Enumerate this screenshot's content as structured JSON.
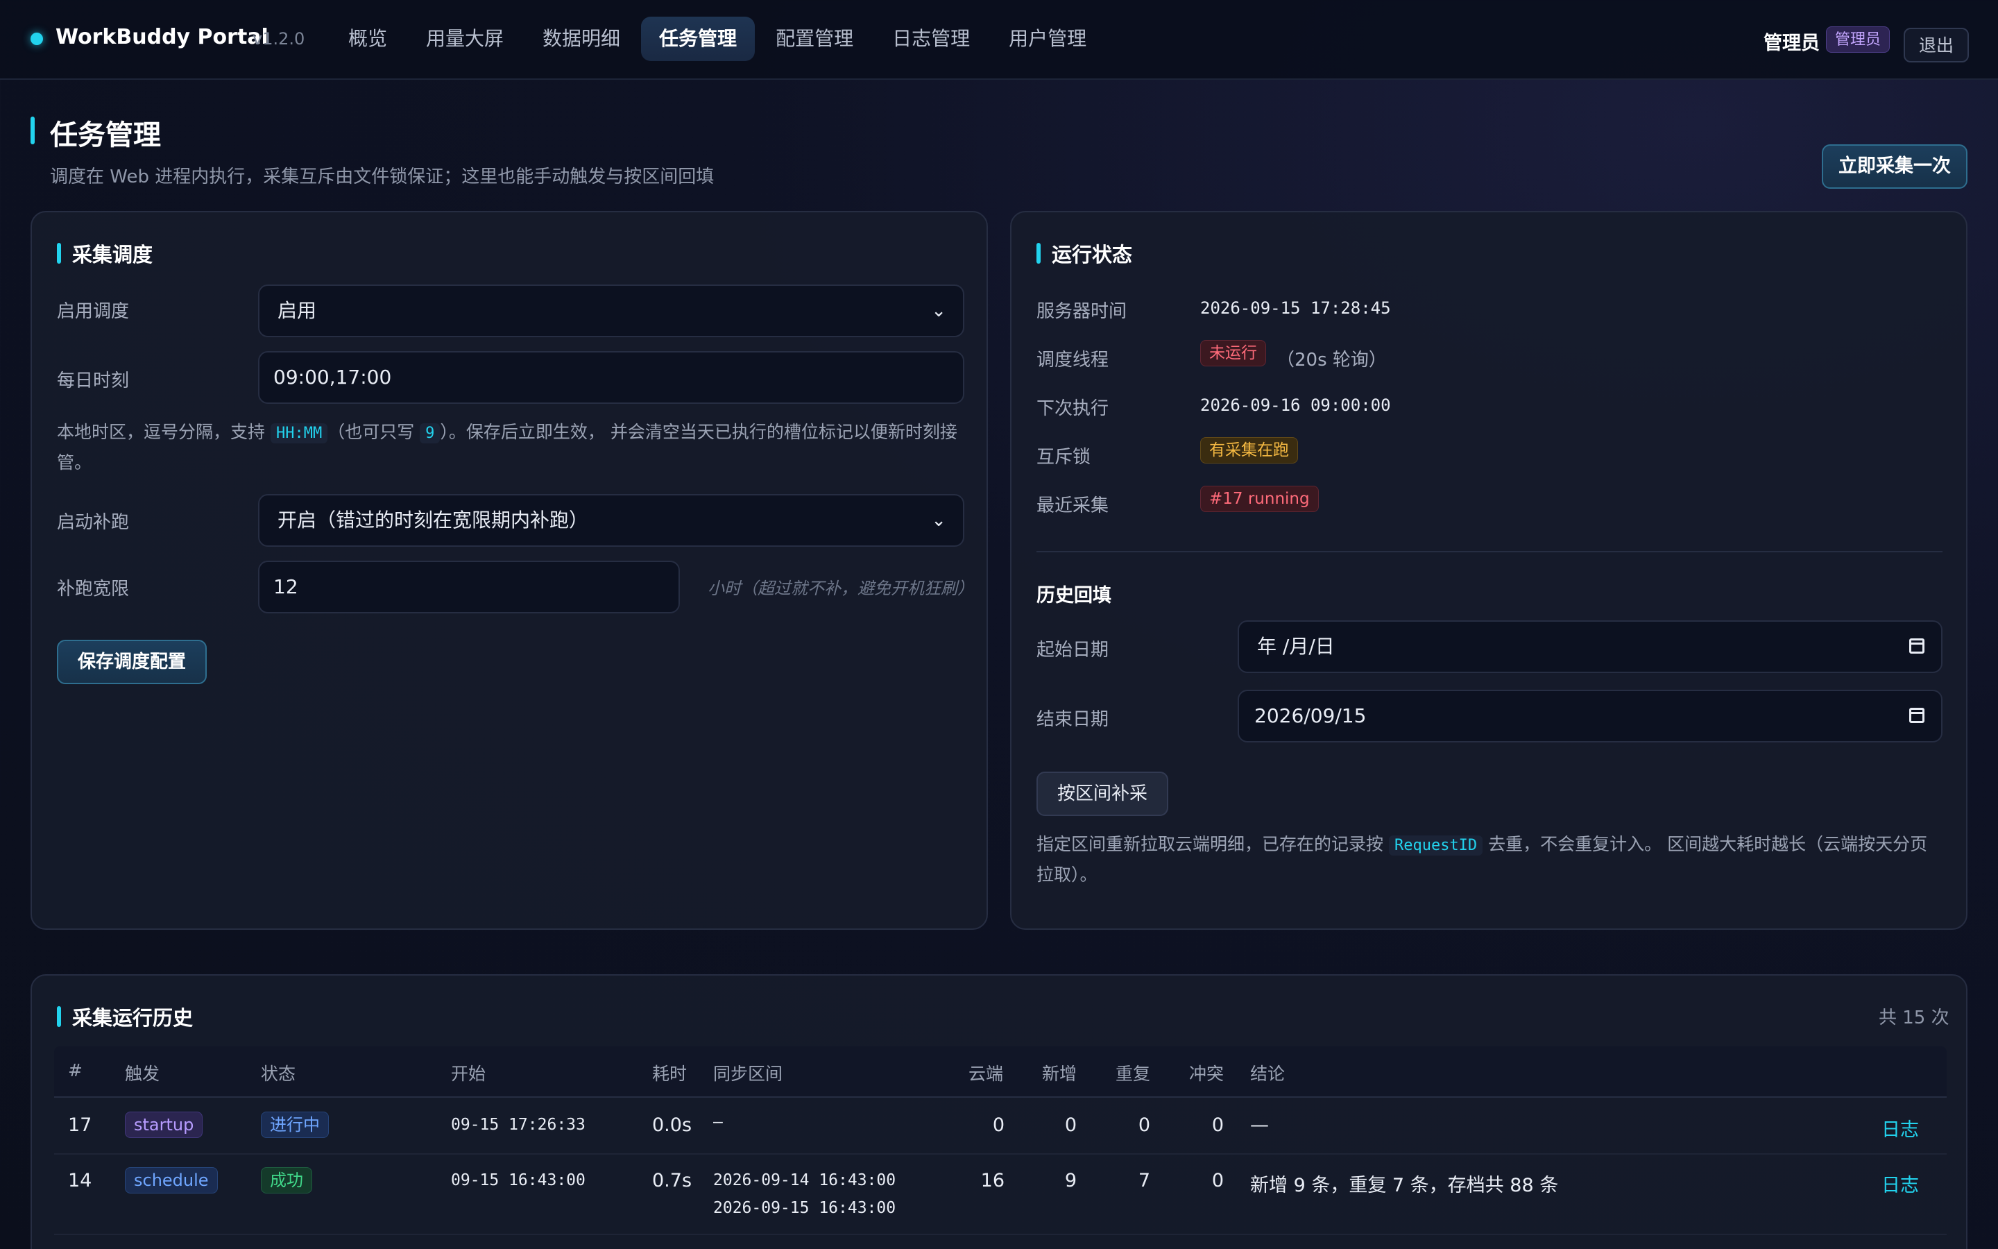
{
  "app": {
    "name": "WorkBuddy Portal",
    "version": "v1.2.0"
  },
  "nav": [
    {
      "label": "概览",
      "active": false
    },
    {
      "label": "用量大屏",
      "active": false
    },
    {
      "label": "数据明细",
      "active": false
    },
    {
      "label": "任务管理",
      "active": true
    },
    {
      "label": "配置管理",
      "active": false
    },
    {
      "label": "日志管理",
      "active": false
    },
    {
      "label": "用户管理",
      "active": false
    }
  ],
  "user": {
    "name": "管理员",
    "role": "管理员",
    "logout": "退出"
  },
  "page": {
    "title": "任务管理",
    "subtitle": "调度在 Web 进程内执行，采集互斥由文件锁保证；这里也能手动触发与按区间回填",
    "collect_now": "立即采集一次"
  },
  "schedule": {
    "title": "采集调度",
    "enable_label": "启用调度",
    "enable_value": "启用",
    "times_label": "每日时刻",
    "times_value": "09:00,17:00",
    "hint_pre": "本地时区，逗号分隔，支持",
    "hint_code1": "HH:MM",
    "hint_mid": "（也可只写",
    "hint_code2": "9",
    "hint_post": "）。保存后立即生效， 并会清空当天已执行的槽位标记以便新时刻接管。",
    "catchup_label": "启动补跑",
    "catchup_value": "开启（错过的时刻在宽限期内补跑）",
    "grace_label": "补跑宽限",
    "grace_value": "12",
    "grace_hint": "小时（超过就不补，避免开机狂刷）",
    "save": "保存调度配置"
  },
  "status": {
    "title": "运行状态",
    "server_time_label": "服务器时间",
    "server_time": "2026-09-15 17:28:45",
    "thread_label": "调度线程",
    "thread_badge": "未运行",
    "thread_note": "（20s 轮询）",
    "next_label": "下次执行",
    "next_value": "2026-09-16 09:00:00",
    "lock_label": "互斥锁",
    "lock_badge": "有采集在跑",
    "last_label": "最近采集",
    "last_badge": "#17 running"
  },
  "backfill": {
    "title": "历史回填",
    "start_label": "起始日期",
    "start_value": "年 /月/日",
    "end_label": "结束日期",
    "end_value": "2026/09/15",
    "button": "按区间补采",
    "hint_pre": "指定区间重新拉取云端明细，已存在的记录按",
    "hint_code": "RequestID",
    "hint_post": "去重，不会重复计入。 区间越大耗时越长（云端按天分页拉取）。"
  },
  "history": {
    "title": "采集运行历史",
    "total": "共 15 次",
    "columns": [
      "#",
      "触发",
      "状态",
      "开始",
      "耗时",
      "同步区间",
      "云端",
      "新增",
      "重复",
      "冲突",
      "结论"
    ],
    "rows": [
      {
        "id": "17",
        "trigger": "startup",
        "status": "进行中",
        "start": "09-15 17:26:33",
        "duration": "0.0s",
        "range1": "–",
        "range2": "",
        "cloud": "0",
        "new": "0",
        "dup": "0",
        "conflict": "0",
        "result": "—",
        "log": "日志"
      },
      {
        "id": "14",
        "trigger": "schedule",
        "status": "成功",
        "start": "09-15 16:43:00",
        "duration": "0.7s",
        "range1": "2026-09-14 16:43:00",
        "range2": "2026-09-15 16:43:00",
        "cloud": "16",
        "new": "9",
        "dup": "7",
        "conflict": "0",
        "result": "新增 9 条，重复 7 条，存档共 88 条",
        "log": "日志"
      }
    ]
  },
  "colors": {
    "accent": "#22d3ee",
    "bg": "#0b0f1c",
    "card": "#161b2a",
    "danger": "#ff6b7a",
    "warn": "#f5b942",
    "success": "#40d98a"
  }
}
